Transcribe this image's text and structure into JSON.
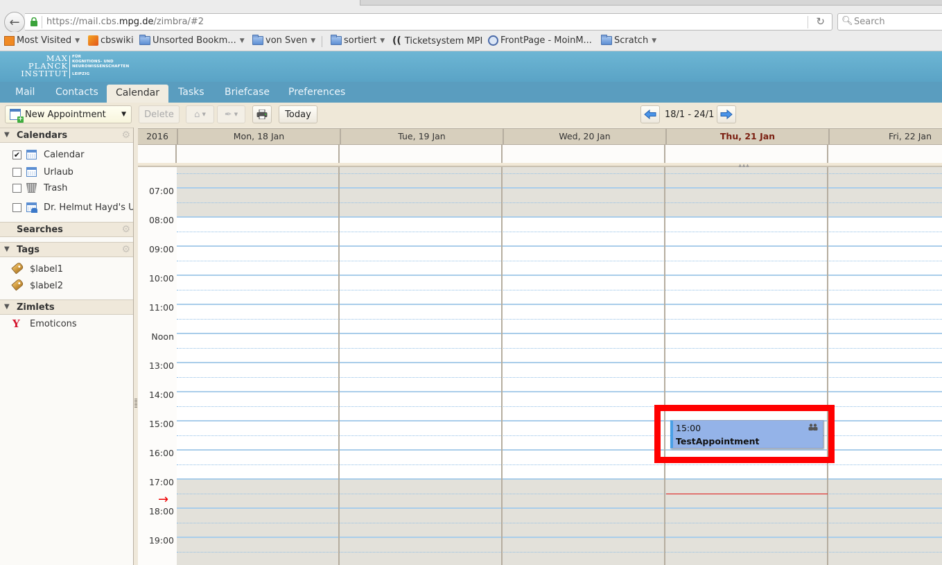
{
  "browser": {
    "url_prefix": "https://mail.cbs.",
    "url_domain": "mpg.de",
    "url_suffix": "/zimbra/#2",
    "search_placeholder": "Search",
    "bookmarks": [
      {
        "label": "Most Visited",
        "icon": "most-visited-icon",
        "dropdown": true
      },
      {
        "label": "cbswiki",
        "icon": "palm-tree-icon",
        "dropdown": false
      },
      {
        "label": "Unsorted Bookm...",
        "icon": "folder-icon",
        "dropdown": true
      },
      {
        "label": "von Sven",
        "icon": "folder-icon",
        "dropdown": true
      },
      {
        "label": "sortiert",
        "icon": "folder-icon",
        "dropdown": true
      },
      {
        "label": "Ticketsystem MPI",
        "icon": "ticket-icon",
        "dropdown": false
      },
      {
        "label": "FrontPage - MoinM...",
        "icon": "moinmoin-icon",
        "dropdown": false
      },
      {
        "label": "Scratch",
        "icon": "folder-icon",
        "dropdown": true
      }
    ]
  },
  "logo": {
    "line1": "MAX",
    "line2": "PLANCK",
    "line3": "INSTITUT",
    "sub1": "FÜR",
    "sub2": "KOGNITIONS- UND",
    "sub3": "NEUROWISSENSCHAFTEN",
    "sub4": "LEIPZIG"
  },
  "app_tabs": [
    {
      "label": "Mail",
      "active": false
    },
    {
      "label": "Contacts",
      "active": false
    },
    {
      "label": "Calendar",
      "active": true
    },
    {
      "label": "Tasks",
      "active": false
    },
    {
      "label": "Briefcase",
      "active": false
    },
    {
      "label": "Preferences",
      "active": false
    }
  ],
  "toolbar": {
    "new_appointment": "New Appointment",
    "delete": "Delete",
    "today": "Today",
    "date_range": "18/1 - 24/1"
  },
  "sidebar": {
    "calendars_title": "Calendars",
    "calendars": [
      {
        "label": "Calendar",
        "checked": true,
        "icon": "calendar-icon"
      },
      {
        "label": "Urlaub",
        "checked": false,
        "icon": "calendar-icon"
      },
      {
        "label": "Trash",
        "checked": false,
        "icon": "trash-icon"
      },
      {
        "label": "Dr. Helmut Hayd's Urlaub",
        "checked": false,
        "icon": "shared-calendar-icon"
      }
    ],
    "searches_title": "Searches",
    "tags_title": "Tags",
    "tags": [
      {
        "label": "$label1"
      },
      {
        "label": "$label2"
      }
    ],
    "zimlets_title": "Zimlets",
    "zimlets": [
      {
        "label": "Emoticons",
        "icon": "yahoo-icon"
      }
    ]
  },
  "calendar": {
    "year": "2016",
    "days": [
      {
        "label": "Mon, 18 Jan",
        "today": false
      },
      {
        "label": "Tue, 19 Jan",
        "today": false
      },
      {
        "label": "Wed, 20 Jan",
        "today": false
      },
      {
        "label": "Thu, 21 Jan",
        "today": true
      },
      {
        "label": "Fri, 22 Jan",
        "today": false
      }
    ],
    "time_labels": [
      "07:00",
      "08:00",
      "09:00",
      "10:00",
      "11:00",
      "Noon",
      "13:00",
      "14:00",
      "15:00",
      "16:00",
      "17:00",
      "18:00",
      "19:00"
    ],
    "working_hours": {
      "start": 8,
      "end": 17
    },
    "current_time": 17.5,
    "appointments": [
      {
        "day": 3,
        "start": 15,
        "end": 16,
        "time_label": "15:00",
        "title": "TestAppointment",
        "has_attendees": true
      }
    ]
  },
  "colors": {
    "highlight_box": "#ff0000",
    "appointment_bg": "#94b3e8",
    "today_header": "#7a1e10",
    "banner": "#5aa3c6"
  }
}
